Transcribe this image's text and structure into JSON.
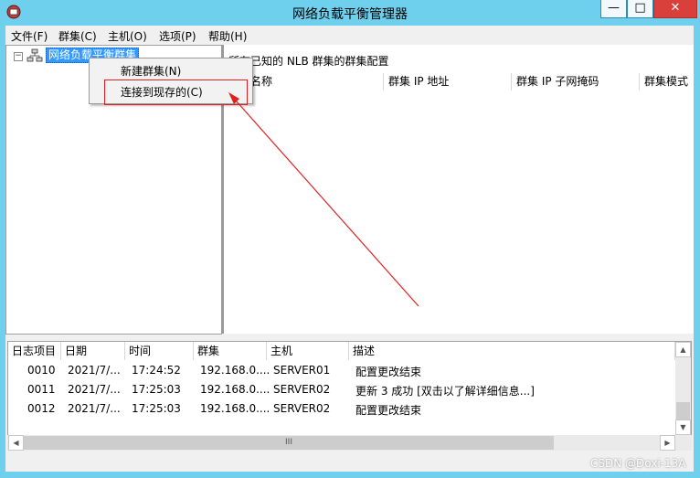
{
  "window": {
    "title": "网络负载平衡管理器",
    "min_symbol": "—",
    "max_symbol": "□",
    "close_symbol": "✕"
  },
  "menu": [
    "文件(F)",
    "群集(C)",
    "主机(O)",
    "选项(P)",
    "帮助(H)"
  ],
  "tree": {
    "expander": "⊟",
    "root_label": "网络负载平衡群集"
  },
  "context_menu": {
    "items": [
      "新建群集(N)",
      "连接到现存的(C)"
    ]
  },
  "main_panel": {
    "title": "所有已知的 NLB 群集的群集配置",
    "columns": [
      "群集名称",
      "群集 IP 地址",
      "群集 IP 子网掩码",
      "群集模式"
    ]
  },
  "log": {
    "columns": [
      "日志项目",
      "日期",
      "时间",
      "群集",
      "主机",
      "描述"
    ],
    "rows": [
      [
        "0010",
        "2021/7/...",
        "17:24:52",
        "192.168.0....",
        "SERVER01",
        "配置更改结束"
      ],
      [
        "0011",
        "2021/7/...",
        "17:25:03",
        "192.168.0....",
        "SERVER02",
        "更新 3 成功 [双击以了解详细信息...]"
      ],
      [
        "0012",
        "2021/7/...",
        "17:25:03",
        "192.168.0....",
        "SERVER02",
        "配置更改结束"
      ]
    ]
  },
  "scroll": {
    "up": "▲",
    "down": "▼",
    "left": "◀",
    "right": "▶",
    "thumb_grip": "III"
  },
  "watermark": "CSDN @Doxi-13A",
  "colors": {
    "titlebar": "#6fd0ee",
    "close_button": "#d9403b",
    "selection": "#3399ff",
    "annotation": "#e02020"
  }
}
